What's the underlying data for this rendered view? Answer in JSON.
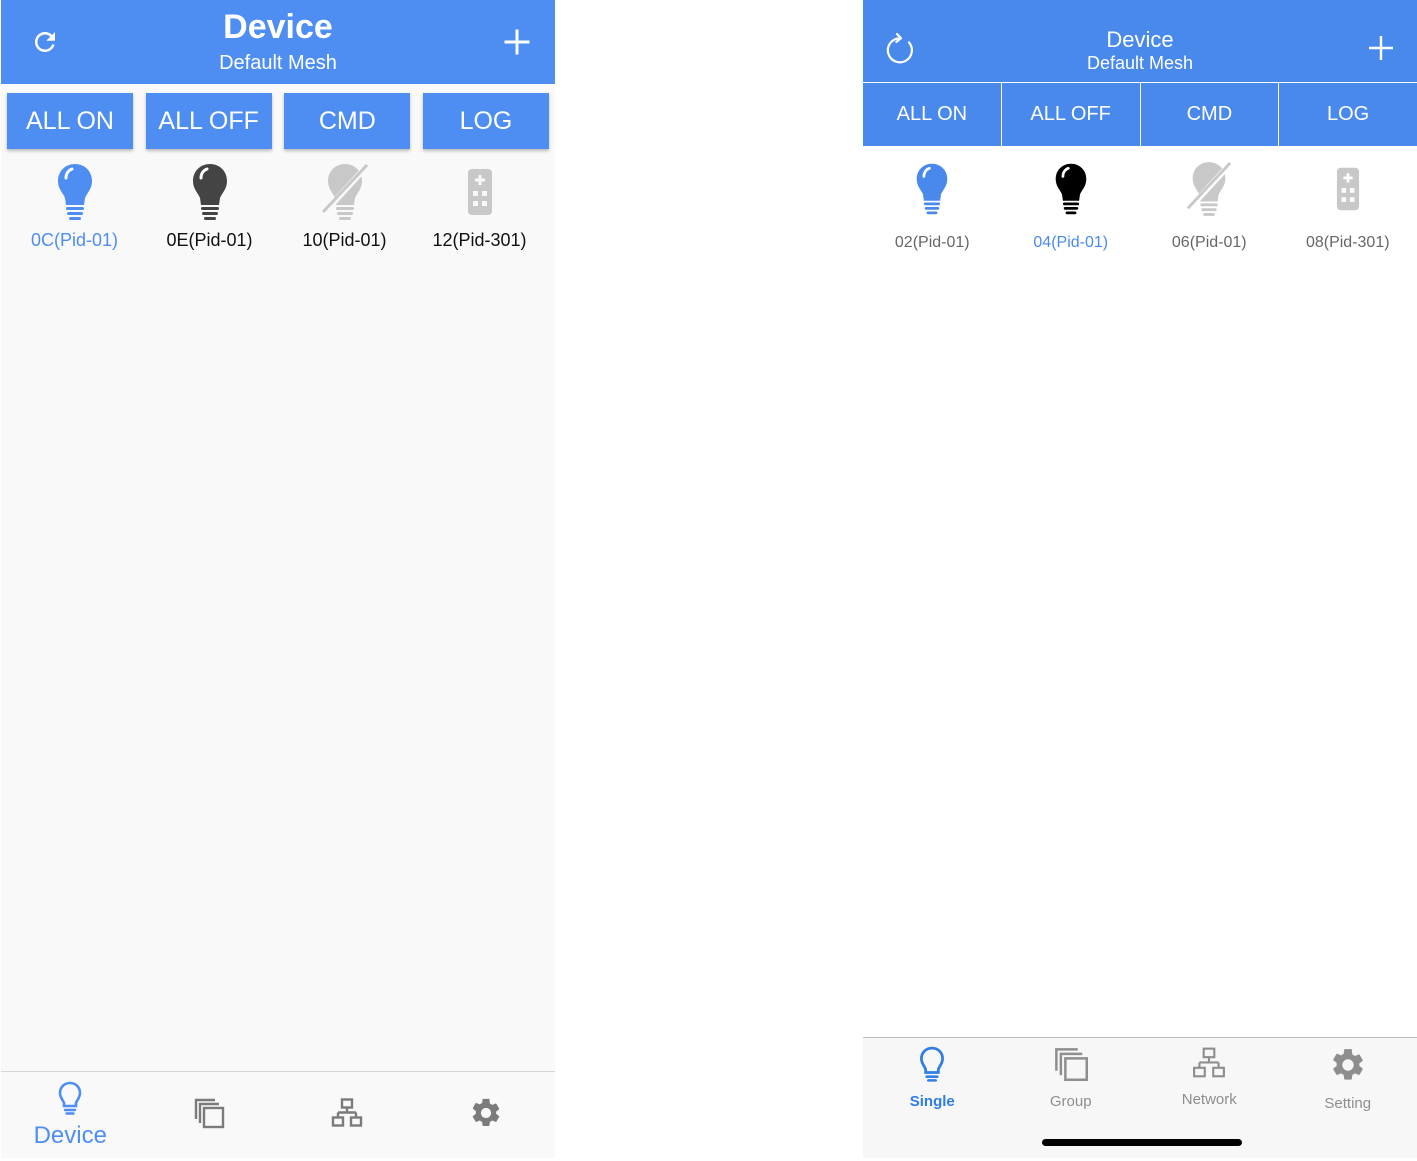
{
  "android": {
    "header": {
      "title": "Device",
      "subtitle": "Default Mesh",
      "left_icon": "refresh-icon",
      "right_icon": "plus-icon"
    },
    "buttons": [
      "ALL ON",
      "ALL OFF",
      "CMD",
      "LOG"
    ],
    "devices": [
      {
        "label": "0C(Pid-01)",
        "icon": "bulb-on-icon",
        "selected": true
      },
      {
        "label": "0E(Pid-01)",
        "icon": "bulb-off-icon",
        "selected": false
      },
      {
        "label": "10(Pid-01)",
        "icon": "bulb-offline-icon",
        "selected": false
      },
      {
        "label": "12(Pid-301)",
        "icon": "remote-icon",
        "selected": false
      }
    ],
    "tabs": [
      {
        "label": "Device",
        "icon": "bulb-outline-icon",
        "active": true
      },
      {
        "label": "",
        "icon": "group-icon",
        "active": false
      },
      {
        "label": "",
        "icon": "network-icon",
        "active": false
      },
      {
        "label": "",
        "icon": "gear-icon",
        "active": false
      }
    ]
  },
  "ios": {
    "header": {
      "title": "Device",
      "subtitle": "Default Mesh",
      "left_icon": "refresh-icon",
      "right_icon": "plus-icon"
    },
    "buttons": [
      "ALL ON",
      "ALL OFF",
      "CMD",
      "LOG"
    ],
    "devices": [
      {
        "label": "02(Pid-01)",
        "icon": "bulb-on-icon",
        "selected": false
      },
      {
        "label": "04(Pid-01)",
        "icon": "bulb-off-icon",
        "selected": true
      },
      {
        "label": "06(Pid-01)",
        "icon": "bulb-offline-icon",
        "selected": false
      },
      {
        "label": "08(Pid-301)",
        "icon": "remote-icon",
        "selected": false
      }
    ],
    "tabs": [
      {
        "label": "Single",
        "icon": "bulb-outline-icon",
        "active": true
      },
      {
        "label": "Group",
        "icon": "group-icon",
        "active": false
      },
      {
        "label": "Network",
        "icon": "network-icon",
        "active": false
      },
      {
        "label": "Setting",
        "icon": "gear-icon",
        "active": false
      }
    ]
  },
  "colors": {
    "primary": "#4e8ef2",
    "primary_ios": "#4a89ec",
    "bulb_off_android": "#444444",
    "bulb_off_ios": "#000000",
    "offline": "#c8c8c8",
    "tab_inactive": "#7b7b7b"
  }
}
